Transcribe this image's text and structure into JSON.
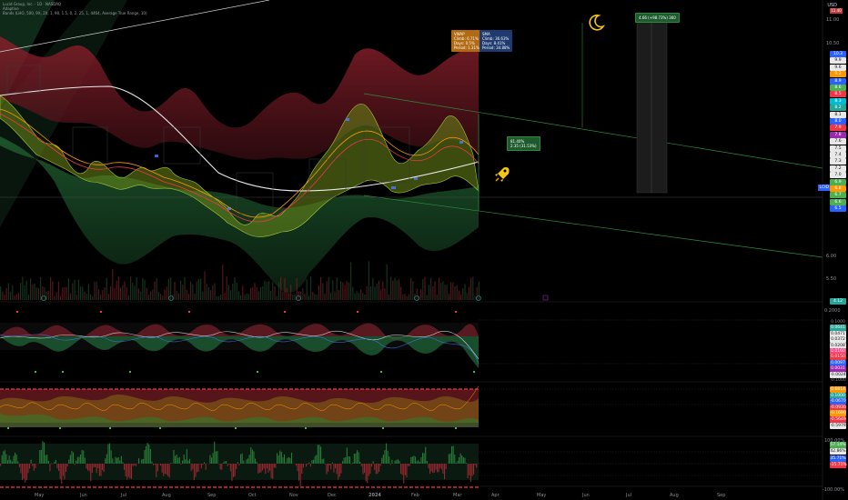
{
  "header": {
    "symbol_line": "Lucid Group, Inc. · 1D · NASDAQ",
    "sub_line_1": "Adaptive",
    "indicator_line": "Bands (LHO, 500, 9X, 2X, 1, 90, 1.5, 0, 2, 25, 1, 4464, Average True Range, 10)",
    "currency": "USD"
  },
  "badges": {
    "orange": "VWAP\nClimb: 6.71%\nDays: 0.5%\nPeriod: 1.31%",
    "blue": "SMA\nClimb: 36.63%\nDays: 8.41%\nPeriod: 34.88%",
    "green_mid": "81.40%\n2.35 (31.53%)",
    "green_top": "4.66 (+98.73%) 360"
  },
  "right_axis": {
    "top_labels": [
      "11.00",
      "10.50"
    ],
    "low_labels": [
      "6.00",
      "5.50"
    ],
    "top_pill": "11.40",
    "price_flag": "5.74",
    "ticker_flag": "LCID",
    "bottom_main": "4.12",
    "pills": [
      {
        "text": "10.3",
        "color": "#2962ff"
      },
      {
        "text": "9.9",
        "color": "#e8e8e8"
      },
      {
        "text": "9.6",
        "color": "#e8e8e8"
      },
      {
        "text": "9.2",
        "color": "#ff9800"
      },
      {
        "text": "8.9",
        "color": "#2962ff"
      },
      {
        "text": "8.6",
        "color": "#4caf50"
      },
      {
        "text": "8.5",
        "color": "#f23645"
      },
      {
        "text": "8.3",
        "color": "#00bcd4"
      },
      {
        "text": "8.2",
        "color": "#26a69a"
      },
      {
        "text": "8.1",
        "color": "#e8e8e8"
      },
      {
        "text": "8.0",
        "color": "#2962ff"
      },
      {
        "text": "7.9",
        "color": "#f23645"
      },
      {
        "text": "7.8",
        "color": "#9c27b0"
      },
      {
        "text": "7.6",
        "color": "#e8e8e8"
      },
      {
        "text": "7.5",
        "color": "#e8e8e8"
      },
      {
        "text": "7.4",
        "color": "#e8e8e8"
      },
      {
        "text": "7.3",
        "color": "#e8e8e8"
      },
      {
        "text": "7.2",
        "color": "#e8e8e8"
      },
      {
        "text": "7.0",
        "color": "#e8e8e8"
      },
      {
        "text": "6.9",
        "color": "#4caf50"
      },
      {
        "text": "6.8",
        "color": "#ff9800"
      },
      {
        "text": "6.7",
        "color": "#4caf50"
      },
      {
        "text": "6.6",
        "color": "#4caf50"
      },
      {
        "text": "6.5",
        "color": "#2962ff"
      }
    ]
  },
  "panel2": {
    "title": "WaveTrend (Lc, Hlc, 10, 21, 60, 53, Cross Table)",
    "axis_top": "0.2000",
    "values": [
      {
        "text": "0.1000",
        "color": "transparent"
      },
      {
        "text": "0.0641",
        "color": "#26a69a"
      },
      {
        "text": "0.0471",
        "color": "#e8e8e8"
      },
      {
        "text": "0.0372",
        "color": "#e8e8e8"
      },
      {
        "text": "0.0208",
        "color": "#e8e8e8"
      },
      {
        "text": "0.0160",
        "color": "#ff4081"
      },
      {
        "text": "0.0150",
        "color": "#f23645"
      },
      {
        "text": "0.0097",
        "color": "#2962ff"
      },
      {
        "text": "0.0031",
        "color": "#9c27b0"
      },
      {
        "text": "-0.0024",
        "color": "#e8e8e8"
      },
      {
        "text": "-0.1000",
        "color": "transparent"
      }
    ]
  },
  "panel3": {
    "values": [
      {
        "text": "0.6814",
        "color": "#ff9800"
      },
      {
        "text": "0.1000",
        "color": "#26a69a"
      },
      {
        "text": "-0.0670",
        "color": "#2962ff"
      },
      {
        "text": "-0.0930",
        "color": "#f23645"
      },
      {
        "text": "-0.1690",
        "color": "#ff9800"
      },
      {
        "text": "-0.5649",
        "color": "#f23645"
      },
      {
        "text": "-0.5979",
        "color": "#e8e8e8"
      }
    ]
  },
  "panel4": {
    "axis_top": "100.00%",
    "axis_bottom": "-100.00%",
    "values": [
      {
        "text": "57.14%",
        "color": "#4caf50"
      },
      {
        "text": "42.86%",
        "color": "#e8e8e8"
      },
      {
        "text": "35.71%",
        "color": "#2962ff"
      },
      {
        "text": "-35.71%",
        "color": "#f23645"
      }
    ]
  },
  "time_axis": {
    "months": [
      "May",
      "Jun",
      "Jul",
      "Aug",
      "Sep",
      "Oct",
      "Nov",
      "Dec",
      "2024",
      "Feb",
      "Mar",
      "Apr",
      "May",
      "Jun",
      "Jul",
      "Aug",
      "Sep"
    ]
  },
  "colors": {
    "bg": "#000000",
    "red_band": "#6b1a22",
    "green_band": "#1b4a2a",
    "trend": "#2e8b3e"
  }
}
